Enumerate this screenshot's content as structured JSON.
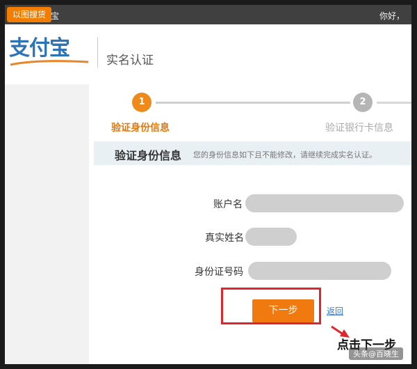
{
  "topbar": {
    "badge": "以图搜货",
    "title_fragment": "宝",
    "greeting": "你好，"
  },
  "header": {
    "logo_text": "支付宝",
    "page_title": "实名认证"
  },
  "steps": [
    {
      "number": "1",
      "label": "验证身份信息",
      "state": "active"
    },
    {
      "number": "2",
      "label": "验证银行卡信息",
      "state": "inactive"
    }
  ],
  "section": {
    "title": "验证身份信息",
    "note": "您的身份信息如下且不能修改，请继续完成实名认证。"
  },
  "form": {
    "account_label": "账户名",
    "realname_label": "真实姓名",
    "idnumber_label": "身份证号码"
  },
  "actions": {
    "next_label": "下一步",
    "back_label": "返回"
  },
  "annotation": "点击下一步",
  "watermark": "头条@百晓生",
  "colors": {
    "brand_blue": "#2c74b5",
    "accent_orange": "#f07a10",
    "highlight_red": "#e0262c",
    "topbar": "#404040"
  }
}
